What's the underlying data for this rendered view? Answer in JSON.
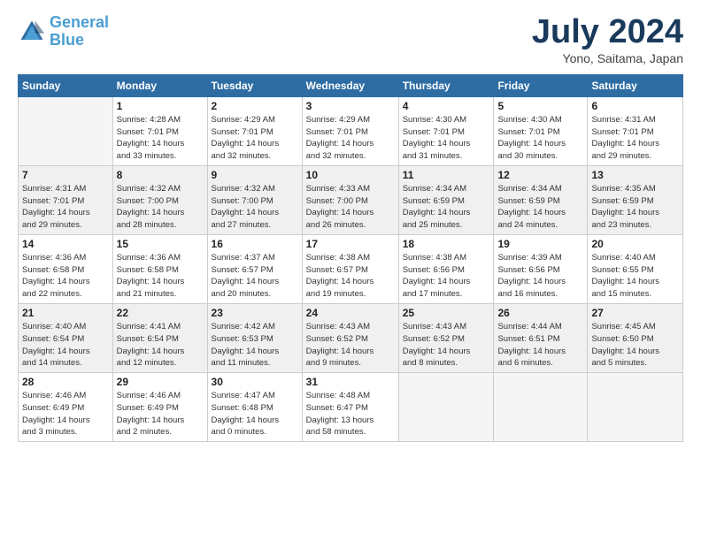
{
  "logo": {
    "line1": "General",
    "line2": "Blue"
  },
  "title": "July 2024",
  "subtitle": "Yono, Saitama, Japan",
  "header_days": [
    "Sunday",
    "Monday",
    "Tuesday",
    "Wednesday",
    "Thursday",
    "Friday",
    "Saturday"
  ],
  "weeks": [
    {
      "shaded": false,
      "days": [
        {
          "num": "",
          "info": ""
        },
        {
          "num": "1",
          "info": "Sunrise: 4:28 AM\nSunset: 7:01 PM\nDaylight: 14 hours\nand 33 minutes."
        },
        {
          "num": "2",
          "info": "Sunrise: 4:29 AM\nSunset: 7:01 PM\nDaylight: 14 hours\nand 32 minutes."
        },
        {
          "num": "3",
          "info": "Sunrise: 4:29 AM\nSunset: 7:01 PM\nDaylight: 14 hours\nand 32 minutes."
        },
        {
          "num": "4",
          "info": "Sunrise: 4:30 AM\nSunset: 7:01 PM\nDaylight: 14 hours\nand 31 minutes."
        },
        {
          "num": "5",
          "info": "Sunrise: 4:30 AM\nSunset: 7:01 PM\nDaylight: 14 hours\nand 30 minutes."
        },
        {
          "num": "6",
          "info": "Sunrise: 4:31 AM\nSunset: 7:01 PM\nDaylight: 14 hours\nand 29 minutes."
        }
      ]
    },
    {
      "shaded": true,
      "days": [
        {
          "num": "7",
          "info": "Sunrise: 4:31 AM\nSunset: 7:01 PM\nDaylight: 14 hours\nand 29 minutes."
        },
        {
          "num": "8",
          "info": "Sunrise: 4:32 AM\nSunset: 7:00 PM\nDaylight: 14 hours\nand 28 minutes."
        },
        {
          "num": "9",
          "info": "Sunrise: 4:32 AM\nSunset: 7:00 PM\nDaylight: 14 hours\nand 27 minutes."
        },
        {
          "num": "10",
          "info": "Sunrise: 4:33 AM\nSunset: 7:00 PM\nDaylight: 14 hours\nand 26 minutes."
        },
        {
          "num": "11",
          "info": "Sunrise: 4:34 AM\nSunset: 6:59 PM\nDaylight: 14 hours\nand 25 minutes."
        },
        {
          "num": "12",
          "info": "Sunrise: 4:34 AM\nSunset: 6:59 PM\nDaylight: 14 hours\nand 24 minutes."
        },
        {
          "num": "13",
          "info": "Sunrise: 4:35 AM\nSunset: 6:59 PM\nDaylight: 14 hours\nand 23 minutes."
        }
      ]
    },
    {
      "shaded": false,
      "days": [
        {
          "num": "14",
          "info": "Sunrise: 4:36 AM\nSunset: 6:58 PM\nDaylight: 14 hours\nand 22 minutes."
        },
        {
          "num": "15",
          "info": "Sunrise: 4:36 AM\nSunset: 6:58 PM\nDaylight: 14 hours\nand 21 minutes."
        },
        {
          "num": "16",
          "info": "Sunrise: 4:37 AM\nSunset: 6:57 PM\nDaylight: 14 hours\nand 20 minutes."
        },
        {
          "num": "17",
          "info": "Sunrise: 4:38 AM\nSunset: 6:57 PM\nDaylight: 14 hours\nand 19 minutes."
        },
        {
          "num": "18",
          "info": "Sunrise: 4:38 AM\nSunset: 6:56 PM\nDaylight: 14 hours\nand 17 minutes."
        },
        {
          "num": "19",
          "info": "Sunrise: 4:39 AM\nSunset: 6:56 PM\nDaylight: 14 hours\nand 16 minutes."
        },
        {
          "num": "20",
          "info": "Sunrise: 4:40 AM\nSunset: 6:55 PM\nDaylight: 14 hours\nand 15 minutes."
        }
      ]
    },
    {
      "shaded": true,
      "days": [
        {
          "num": "21",
          "info": "Sunrise: 4:40 AM\nSunset: 6:54 PM\nDaylight: 14 hours\nand 14 minutes."
        },
        {
          "num": "22",
          "info": "Sunrise: 4:41 AM\nSunset: 6:54 PM\nDaylight: 14 hours\nand 12 minutes."
        },
        {
          "num": "23",
          "info": "Sunrise: 4:42 AM\nSunset: 6:53 PM\nDaylight: 14 hours\nand 11 minutes."
        },
        {
          "num": "24",
          "info": "Sunrise: 4:43 AM\nSunset: 6:52 PM\nDaylight: 14 hours\nand 9 minutes."
        },
        {
          "num": "25",
          "info": "Sunrise: 4:43 AM\nSunset: 6:52 PM\nDaylight: 14 hours\nand 8 minutes."
        },
        {
          "num": "26",
          "info": "Sunrise: 4:44 AM\nSunset: 6:51 PM\nDaylight: 14 hours\nand 6 minutes."
        },
        {
          "num": "27",
          "info": "Sunrise: 4:45 AM\nSunset: 6:50 PM\nDaylight: 14 hours\nand 5 minutes."
        }
      ]
    },
    {
      "shaded": false,
      "days": [
        {
          "num": "28",
          "info": "Sunrise: 4:46 AM\nSunset: 6:49 PM\nDaylight: 14 hours\nand 3 minutes."
        },
        {
          "num": "29",
          "info": "Sunrise: 4:46 AM\nSunset: 6:49 PM\nDaylight: 14 hours\nand 2 minutes."
        },
        {
          "num": "30",
          "info": "Sunrise: 4:47 AM\nSunset: 6:48 PM\nDaylight: 14 hours\nand 0 minutes."
        },
        {
          "num": "31",
          "info": "Sunrise: 4:48 AM\nSunset: 6:47 PM\nDaylight: 13 hours\nand 58 minutes."
        },
        {
          "num": "",
          "info": ""
        },
        {
          "num": "",
          "info": ""
        },
        {
          "num": "",
          "info": ""
        }
      ]
    }
  ]
}
